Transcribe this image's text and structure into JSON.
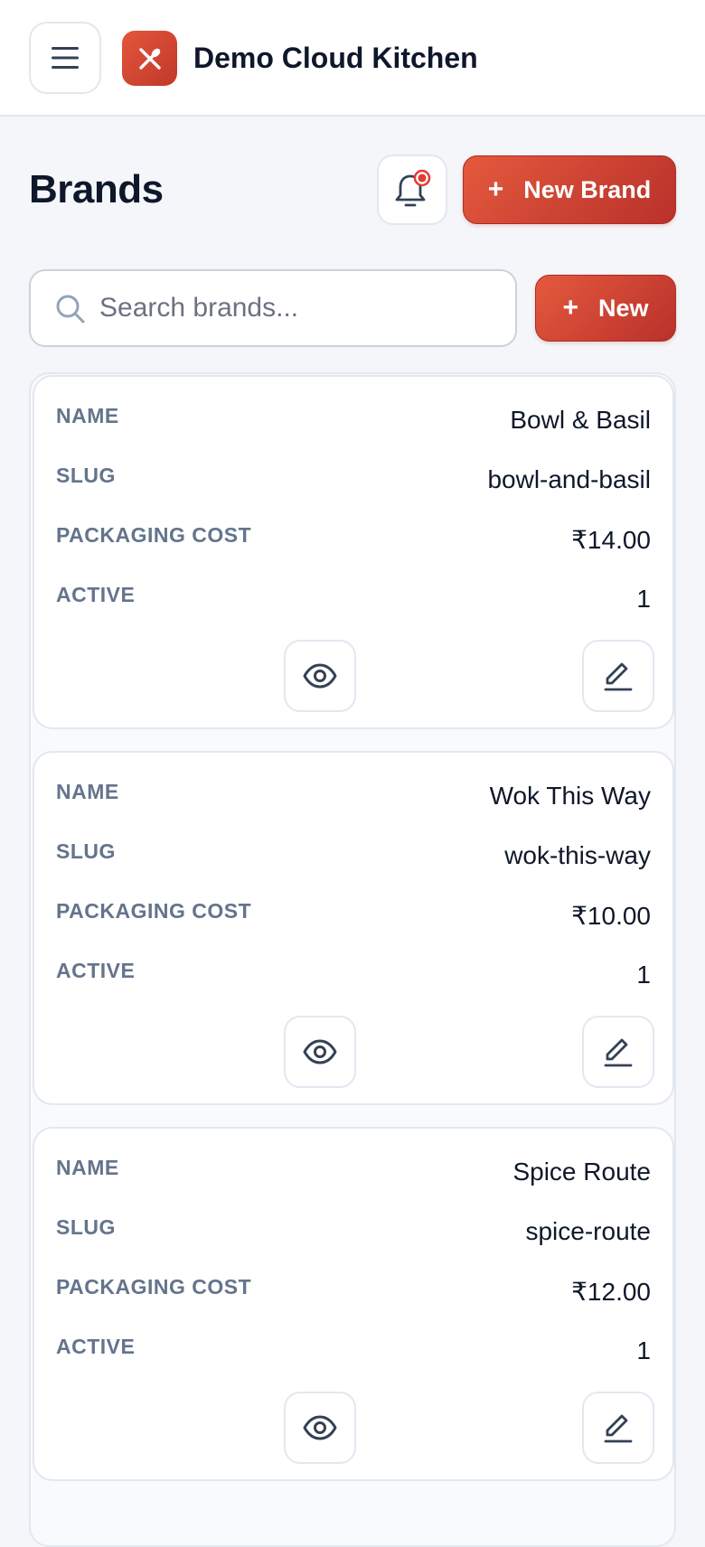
{
  "header": {
    "app_title": "Demo Cloud Kitchen"
  },
  "page": {
    "title": "Brands",
    "new_brand_label": "New Brand",
    "new_label": "New"
  },
  "search": {
    "placeholder": "Search brands...",
    "value": ""
  },
  "labels": {
    "name": "NAME",
    "slug": "SLUG",
    "packaging_cost": "PACKAGING COST",
    "active": "ACTIVE"
  },
  "brands": [
    {
      "name": "Bowl & Basil",
      "slug": "bowl-and-basil",
      "packaging_cost": "₹14.00",
      "active": "1"
    },
    {
      "name": "Wok This Way",
      "slug": "wok-this-way",
      "packaging_cost": "₹10.00",
      "active": "1"
    },
    {
      "name": "Spice Route",
      "slug": "spice-route",
      "packaging_cost": "₹12.00",
      "active": "1"
    }
  ],
  "colors": {
    "accent": "#d9473a",
    "notification_dot": "#e53935",
    "label": "#64748b",
    "text": "#0f172a"
  }
}
